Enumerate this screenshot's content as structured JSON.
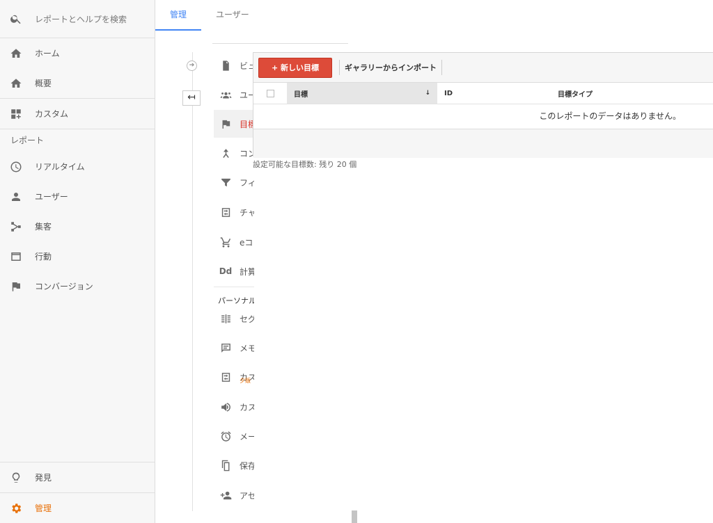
{
  "sidebar": {
    "search_placeholder": "レポートとヘルプを検索",
    "nav_top": [
      {
        "label": "ホーム",
        "icon": "home-icon"
      },
      {
        "label": "概要",
        "icon": "home-icon"
      },
      {
        "label": "カスタム",
        "icon": "dashboard-icon"
      }
    ],
    "section_label": "レポート",
    "reports": [
      {
        "label": "リアルタイム",
        "icon": "clock-icon"
      },
      {
        "label": "ユーザー",
        "icon": "person-icon"
      },
      {
        "label": "集客",
        "icon": "acquisition-icon"
      },
      {
        "label": "行動",
        "icon": "behavior-icon"
      },
      {
        "label": "コンバージョン",
        "icon": "flag-icon"
      }
    ],
    "bottom": [
      {
        "label": "発見",
        "icon": "lightbulb-icon"
      },
      {
        "label": "管理",
        "icon": "gear-icon",
        "active": true
      }
    ]
  },
  "tabs": [
    {
      "label": "管理",
      "active": true
    },
    {
      "label": "ユーザー",
      "active": false
    }
  ],
  "view_menu": {
    "items": [
      {
        "label": "ビュ",
        "icon": "document-icon"
      },
      {
        "label": "ユー",
        "icon": "users-icon"
      },
      {
        "label": "目標",
        "icon": "flag-icon",
        "active": true
      },
      {
        "label": "コン",
        "icon": "merge-icon"
      },
      {
        "label": "フィ",
        "icon": "filter-icon"
      },
      {
        "label": "チャ",
        "icon": "channel-icon"
      },
      {
        "label": "eコ",
        "icon": "cart-icon"
      },
      {
        "label": "計算",
        "icon": "dd-icon"
      }
    ],
    "section_label": "パーソナル",
    "personal_items": [
      {
        "label": "セグ",
        "icon": "segment-icon"
      },
      {
        "label": "メモ",
        "icon": "comment-icon"
      },
      {
        "label": "カス",
        "icon": "channel-icon",
        "sub": "夕贩"
      },
      {
        "label": "カス",
        "icon": "megaphone-icon"
      },
      {
        "label": "メー",
        "icon": "alarm-icon"
      },
      {
        "label": "保存",
        "icon": "copy-icon"
      },
      {
        "label": "アセ",
        "icon": "add-person-icon"
      }
    ]
  },
  "goals": {
    "new_goal_label": "+ 新しい目標",
    "gallery_import_label": "ギャラリーからインポート",
    "columns": [
      "目標",
      "ID",
      "目標タイプ"
    ],
    "sort_indicator": "↓",
    "empty_message": "このレポートのデータはありません。",
    "remaining_text": "設定可能な目標数: 残り 20 個"
  },
  "controls": {
    "back_arrow": "↤",
    "timeline_marker": "➔"
  }
}
